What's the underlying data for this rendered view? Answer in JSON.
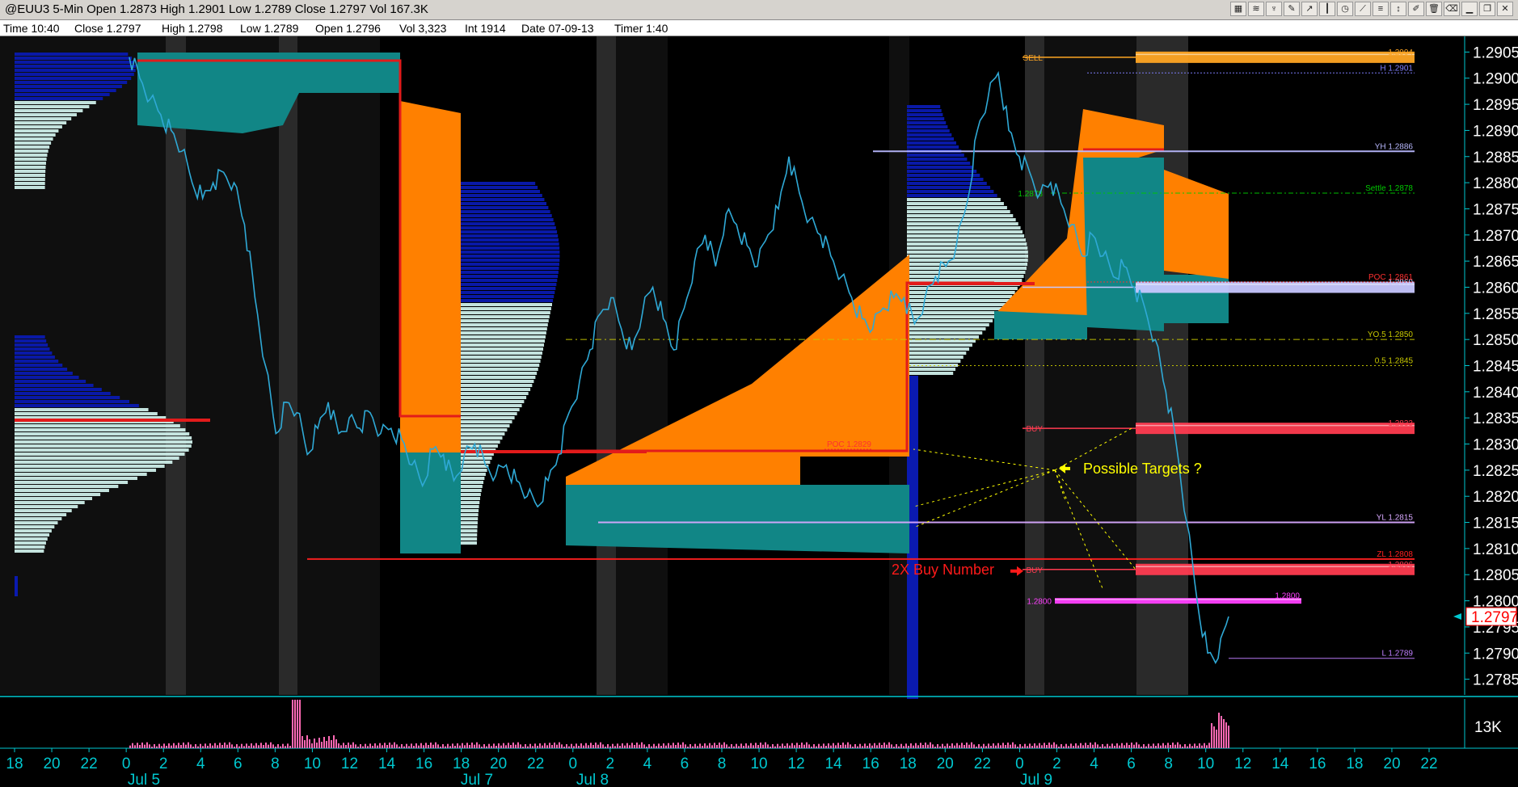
{
  "window": {
    "title": "@EUU3 5-Min Open 1.2873 High 1.2901 Low 1.2789 Close 1.2797 Vol 167.3K",
    "toolbar_icons": [
      "chart-style-icon",
      "zoom-icon",
      "pattern-icon",
      "pencil-icon",
      "draw-icon",
      "hline-icon",
      "clock-icon",
      "line-tool-icon",
      "fib-tool-icon",
      "arrow-tool-icon",
      "text-tool-icon",
      "delete-icon",
      "eraser-icon",
      "minimize-icon",
      "restore-icon",
      "close-icon"
    ],
    "toolbar_glyphs": [
      "▦",
      "≋",
      "♆",
      "✎",
      "↗",
      "┃",
      "◷",
      "⟋",
      "≡",
      "↕",
      "✐",
      "🗑",
      "⌫",
      "▁",
      "❐",
      "✕"
    ]
  },
  "infobar": {
    "time": "Time 10:40",
    "close": "Close 1.2797",
    "high": "High 1.2798",
    "low": "Low 1.2789",
    "open": "Open 1.2796",
    "vol": "Vol 3,323",
    "int": "Int 1914",
    "date": "Date 07-09-13",
    "timer": "Timer 1:40"
  },
  "colors": {
    "background": "#000000",
    "price_line": "#2fa9d6",
    "orange_fill": "#ff8000",
    "teal_fill": "#118686",
    "profile_blue": "#0a1ab0",
    "profile_light": "#cdeee9",
    "poc_red": "#e21b1b",
    "axis_text": "#00c8d0",
    "volume": "#ff69b4",
    "annotation_yellow": "#ffff00",
    "annotation_red": "#ff1a1a"
  },
  "chart_data": {
    "type": "line",
    "title": "@EUU3 5-Min",
    "ylim": [
      1.2782,
      1.2908
    ],
    "y_ticks": [
      1.2785,
      1.279,
      1.2795,
      1.28,
      1.2805,
      1.281,
      1.2815,
      1.282,
      1.2825,
      1.283,
      1.2835,
      1.284,
      1.2845,
      1.285,
      1.2855,
      1.286,
      1.2865,
      1.287,
      1.2875,
      1.288,
      1.2885,
      1.289,
      1.2895,
      1.29,
      1.2905
    ],
    "y_tick_labels": [
      "1.2785",
      "1.2790",
      "1.2795",
      "1.2800",
      "1.2805",
      "1.2810",
      "1.2815",
      "1.2820",
      "1.2825",
      "1.2830",
      "1.2835",
      "1.2840",
      "1.2845",
      "1.2850",
      "1.2855",
      "1.2860",
      "1.2865",
      "1.2870",
      "1.2875",
      "1.2880",
      "1.2885",
      "1.2890",
      "1.2895",
      "1.2900",
      "1.2905"
    ],
    "x_ticks": [
      "18",
      "20",
      "22",
      "0",
      "2",
      "4",
      "6",
      "8",
      "10",
      "12",
      "14",
      "16",
      "18",
      "20",
      "22",
      "0",
      "2",
      "4",
      "6",
      "8",
      "10",
      "12",
      "14",
      "16",
      "18",
      "20",
      "22",
      "0",
      "2",
      "4",
      "6",
      "8",
      "10",
      "12",
      "14",
      "16",
      "18",
      "20",
      "22"
    ],
    "x_dates": [
      "Jul 5",
      "Jul 7",
      "Jul 8",
      "Jul 9"
    ],
    "last_price": "1.2797",
    "volume_axis_label": "13K",
    "series": [
      {
        "values": [
          1.2904,
          1.29,
          1.2896,
          1.2893,
          1.289,
          1.2886,
          1.288,
          1.2877,
          1.288,
          1.2882,
          1.288,
          1.2872,
          1.2858,
          1.2845,
          1.2832,
          1.2838,
          1.2836,
          1.2828,
          1.2833,
          1.2838,
          1.2832,
          1.2835,
          1.2833,
          1.2836,
          1.2832,
          1.2833,
          1.2831,
          1.2826,
          1.2822,
          1.2829,
          1.2828,
          1.2823,
          1.2828,
          1.283,
          1.2826,
          1.2824,
          1.2826,
          1.2823,
          1.282,
          1.2818,
          1.2823,
          1.2828,
          1.2836,
          1.2842,
          1.2848,
          1.2855,
          1.2858,
          1.2852,
          1.2848,
          1.2855,
          1.286,
          1.2854,
          1.2848,
          1.2856,
          1.2865,
          1.287,
          1.2864,
          1.2874,
          1.2872,
          1.2868,
          1.2864,
          1.287,
          1.2875,
          1.2885,
          1.2878,
          1.2873,
          1.287,
          1.2866,
          1.2862,
          1.2858,
          1.2854,
          1.2852,
          1.2856,
          1.2858,
          1.2858,
          1.2853,
          1.2858,
          1.2862,
          1.2864,
          1.2868,
          1.2876,
          1.289,
          1.2896,
          1.2901,
          1.289,
          1.2885,
          1.2882,
          1.2878,
          1.288,
          1.2876,
          1.2872,
          1.2866,
          1.287,
          1.2866,
          1.2862,
          1.2864,
          1.286,
          1.2856,
          1.285,
          1.284,
          1.283,
          1.2815,
          1.28,
          1.279,
          1.2789,
          1.2797
        ]
      }
    ],
    "levels": [
      {
        "label_left": "SELL",
        "label_right": "1.2904",
        "value": 1.2904
      },
      {
        "label_right": "H 1.2901",
        "value": 1.2901
      },
      {
        "label_right": "YH 1.2886",
        "value": 1.2886
      },
      {
        "label_left": "1.2878",
        "label_right": "Settle 1.2878",
        "value": 1.2878
      },
      {
        "label_right": "1.2860",
        "value": 1.286
      },
      {
        "label_right": "POC 1.2861",
        "value": 1.2861
      },
      {
        "label_right": "YO.5 1.2850",
        "value": 1.285
      },
      {
        "label_right": "0.5 1.2845",
        "value": 1.2845
      },
      {
        "label_left": "BUY",
        "label_right": "1.2833",
        "value": 1.2833
      },
      {
        "label_right": "POC 1.2829",
        "value": 1.2829
      },
      {
        "label_right": "YL 1.2815",
        "value": 1.2815
      },
      {
        "label_right": "ZL 1.2808",
        "value": 1.2808
      },
      {
        "label_left": "BUY",
        "label_right": "1.2806",
        "value": 1.2806
      },
      {
        "label_left": "1.2800",
        "label_right": "1.2800",
        "value": 1.28
      },
      {
        "label_right": "L 1.2789",
        "value": 1.2789
      }
    ],
    "annotations": {
      "targets": "Possible Targets ?",
      "buy_number": "2X Buy Number"
    }
  }
}
